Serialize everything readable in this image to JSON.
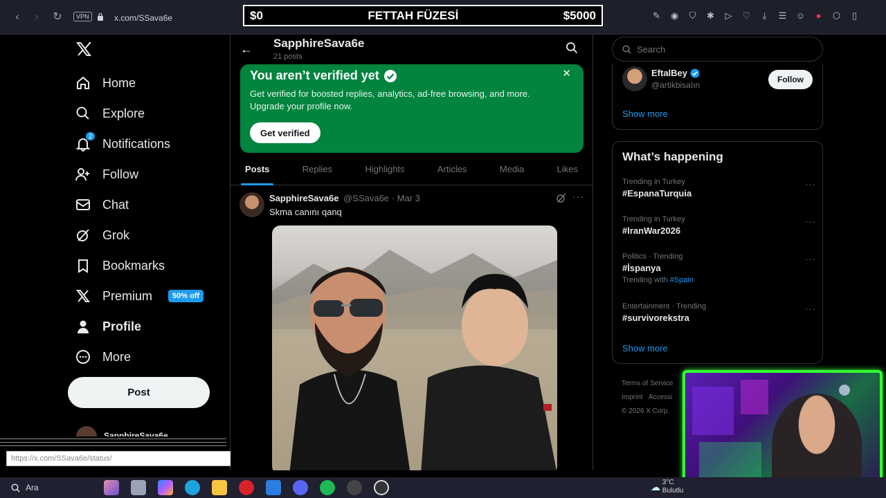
{
  "browser": {
    "vpn_label": "VPN",
    "url": "x.com/SSava6e"
  },
  "stream_banner": {
    "left": "$0",
    "title": "FETTAH FÜZESİ",
    "right": "$5000"
  },
  "nav": {
    "items": [
      {
        "label": "Home",
        "icon": "home-icon"
      },
      {
        "label": "Explore",
        "icon": "search-icon"
      },
      {
        "label": "Notifications",
        "icon": "bell-icon",
        "badge": "2"
      },
      {
        "label": "Follow",
        "icon": "person-add-icon"
      },
      {
        "label": "Chat",
        "icon": "mail-icon"
      },
      {
        "label": "Grok",
        "icon": "grok-icon"
      },
      {
        "label": "Bookmarks",
        "icon": "bookmark-icon"
      },
      {
        "label": "Premium",
        "icon": "x-logo-icon",
        "pill": "50% off"
      },
      {
        "label": "Profile",
        "icon": "person-icon"
      },
      {
        "label": "More",
        "icon": "more-circle-icon"
      }
    ],
    "post_button": "Post",
    "account_name": "SapphireSava6e"
  },
  "profile": {
    "name": "SapphireSava6e",
    "post_count": "21 posts"
  },
  "verify_banner": {
    "title": "You aren’t verified yet",
    "description": "Get verified for boosted replies, analytics, ad-free browsing, and more. Upgrade your profile now.",
    "button": "Get verified"
  },
  "tabs": [
    "Posts",
    "Replies",
    "Highlights",
    "Articles",
    "Media",
    "Likes"
  ],
  "post": {
    "author": "SapphireSava6e",
    "handle": "@SSava6e",
    "separator": "·",
    "date": "Mar 3",
    "text": "Skma canını qanq"
  },
  "right": {
    "search_placeholder": "Search",
    "who_to_follow": {
      "name": "EftalBey",
      "handle": "@artikbisaIın",
      "button": "Follow",
      "show_more": "Show more"
    },
    "whats_happening": {
      "title": "What’s happening",
      "trends": [
        {
          "category": "Trending in Turkey",
          "tag": "#EspanaTurquia"
        },
        {
          "category": "Trending in Turkey",
          "tag": "#IranWar2026"
        },
        {
          "category": "Politics · Trending",
          "tag": "#İspanya",
          "with_label": "Trending with",
          "with_tag": "#Spain"
        },
        {
          "category": "Entertainment · Trending",
          "tag": "#survivorekstra"
        }
      ],
      "show_more": "Show more"
    },
    "footer": {
      "terms": "Terms of Service",
      "imprint": "Imprint",
      "access": "Accessi",
      "copyright": "© 2026 X Corp."
    }
  },
  "taskbar": {
    "search_label": "Ara",
    "temp": "3°C",
    "weather": "Bulutlu"
  },
  "colors": {
    "accent": "#1d9bf0",
    "verify_green": "#00843e",
    "cam_border": "#33ff33"
  }
}
